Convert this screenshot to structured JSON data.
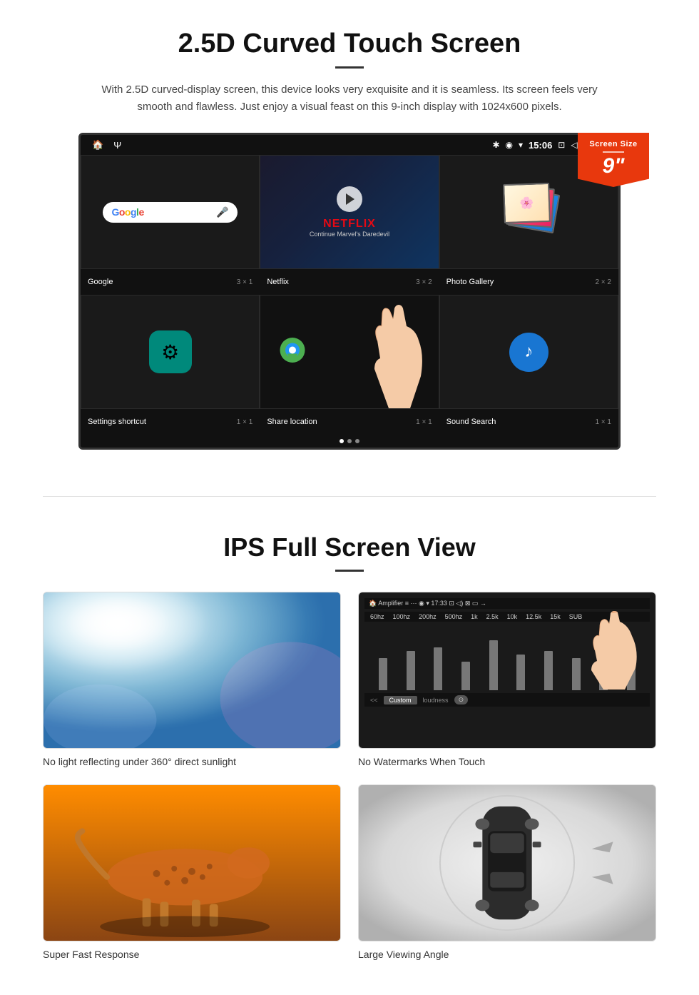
{
  "section1": {
    "title": "2.5D Curved Touch Screen",
    "description": "With 2.5D curved-display screen, this device looks very exquisite and it is seamless. Its screen feels very smooth and flawless. Just enjoy a visual feast on this 9-inch display with 1024x600 pixels.",
    "badge": {
      "title": "Screen Size",
      "size": "9\""
    },
    "statusbar": {
      "time": "15:06"
    },
    "apps": [
      {
        "name": "Google",
        "size": "3 × 1"
      },
      {
        "name": "Netflix",
        "size": "3 × 2"
      },
      {
        "name": "Photo Gallery",
        "size": "2 × 2"
      },
      {
        "name": "Settings shortcut",
        "size": "1 × 1"
      },
      {
        "name": "Share location",
        "size": "1 × 1"
      },
      {
        "name": "Sound Search",
        "size": "1 × 1"
      }
    ],
    "netflix": {
      "logo": "NETFLIX",
      "subtitle": "Continue Marvel's Daredevil"
    }
  },
  "section2": {
    "title": "IPS Full Screen View",
    "features": [
      {
        "label": "No light reflecting under 360° direct sunlight"
      },
      {
        "label": "No Watermarks When Touch"
      },
      {
        "label": "Super Fast Response"
      },
      {
        "label": "Large Viewing Angle"
      }
    ]
  }
}
